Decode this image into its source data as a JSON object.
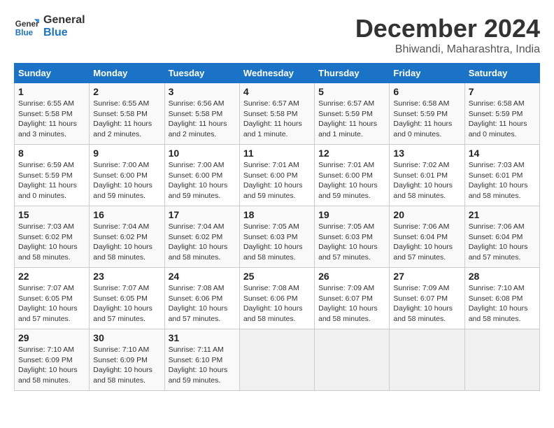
{
  "logo": {
    "text_line1": "General",
    "text_line2": "Blue"
  },
  "title": "December 2024",
  "location": "Bhiwandi, Maharashtra, India",
  "weekdays": [
    "Sunday",
    "Monday",
    "Tuesday",
    "Wednesday",
    "Thursday",
    "Friday",
    "Saturday"
  ],
  "weeks": [
    [
      {
        "day": "1",
        "info": "Sunrise: 6:55 AM\nSunset: 5:58 PM\nDaylight: 11 hours\nand 3 minutes."
      },
      {
        "day": "2",
        "info": "Sunrise: 6:55 AM\nSunset: 5:58 PM\nDaylight: 11 hours\nand 2 minutes."
      },
      {
        "day": "3",
        "info": "Sunrise: 6:56 AM\nSunset: 5:58 PM\nDaylight: 11 hours\nand 2 minutes."
      },
      {
        "day": "4",
        "info": "Sunrise: 6:57 AM\nSunset: 5:58 PM\nDaylight: 11 hours\nand 1 minute."
      },
      {
        "day": "5",
        "info": "Sunrise: 6:57 AM\nSunset: 5:59 PM\nDaylight: 11 hours\nand 1 minute."
      },
      {
        "day": "6",
        "info": "Sunrise: 6:58 AM\nSunset: 5:59 PM\nDaylight: 11 hours\nand 0 minutes."
      },
      {
        "day": "7",
        "info": "Sunrise: 6:58 AM\nSunset: 5:59 PM\nDaylight: 11 hours\nand 0 minutes."
      }
    ],
    [
      {
        "day": "8",
        "info": "Sunrise: 6:59 AM\nSunset: 5:59 PM\nDaylight: 11 hours\nand 0 minutes."
      },
      {
        "day": "9",
        "info": "Sunrise: 7:00 AM\nSunset: 6:00 PM\nDaylight: 10 hours\nand 59 minutes."
      },
      {
        "day": "10",
        "info": "Sunrise: 7:00 AM\nSunset: 6:00 PM\nDaylight: 10 hours\nand 59 minutes."
      },
      {
        "day": "11",
        "info": "Sunrise: 7:01 AM\nSunset: 6:00 PM\nDaylight: 10 hours\nand 59 minutes."
      },
      {
        "day": "12",
        "info": "Sunrise: 7:01 AM\nSunset: 6:00 PM\nDaylight: 10 hours\nand 59 minutes."
      },
      {
        "day": "13",
        "info": "Sunrise: 7:02 AM\nSunset: 6:01 PM\nDaylight: 10 hours\nand 58 minutes."
      },
      {
        "day": "14",
        "info": "Sunrise: 7:03 AM\nSunset: 6:01 PM\nDaylight: 10 hours\nand 58 minutes."
      }
    ],
    [
      {
        "day": "15",
        "info": "Sunrise: 7:03 AM\nSunset: 6:02 PM\nDaylight: 10 hours\nand 58 minutes."
      },
      {
        "day": "16",
        "info": "Sunrise: 7:04 AM\nSunset: 6:02 PM\nDaylight: 10 hours\nand 58 minutes."
      },
      {
        "day": "17",
        "info": "Sunrise: 7:04 AM\nSunset: 6:02 PM\nDaylight: 10 hours\nand 58 minutes."
      },
      {
        "day": "18",
        "info": "Sunrise: 7:05 AM\nSunset: 6:03 PM\nDaylight: 10 hours\nand 58 minutes."
      },
      {
        "day": "19",
        "info": "Sunrise: 7:05 AM\nSunset: 6:03 PM\nDaylight: 10 hours\nand 57 minutes."
      },
      {
        "day": "20",
        "info": "Sunrise: 7:06 AM\nSunset: 6:04 PM\nDaylight: 10 hours\nand 57 minutes."
      },
      {
        "day": "21",
        "info": "Sunrise: 7:06 AM\nSunset: 6:04 PM\nDaylight: 10 hours\nand 57 minutes."
      }
    ],
    [
      {
        "day": "22",
        "info": "Sunrise: 7:07 AM\nSunset: 6:05 PM\nDaylight: 10 hours\nand 57 minutes."
      },
      {
        "day": "23",
        "info": "Sunrise: 7:07 AM\nSunset: 6:05 PM\nDaylight: 10 hours\nand 57 minutes."
      },
      {
        "day": "24",
        "info": "Sunrise: 7:08 AM\nSunset: 6:06 PM\nDaylight: 10 hours\nand 57 minutes."
      },
      {
        "day": "25",
        "info": "Sunrise: 7:08 AM\nSunset: 6:06 PM\nDaylight: 10 hours\nand 58 minutes."
      },
      {
        "day": "26",
        "info": "Sunrise: 7:09 AM\nSunset: 6:07 PM\nDaylight: 10 hours\nand 58 minutes."
      },
      {
        "day": "27",
        "info": "Sunrise: 7:09 AM\nSunset: 6:07 PM\nDaylight: 10 hours\nand 58 minutes."
      },
      {
        "day": "28",
        "info": "Sunrise: 7:10 AM\nSunset: 6:08 PM\nDaylight: 10 hours\nand 58 minutes."
      }
    ],
    [
      {
        "day": "29",
        "info": "Sunrise: 7:10 AM\nSunset: 6:09 PM\nDaylight: 10 hours\nand 58 minutes."
      },
      {
        "day": "30",
        "info": "Sunrise: 7:10 AM\nSunset: 6:09 PM\nDaylight: 10 hours\nand 58 minutes."
      },
      {
        "day": "31",
        "info": "Sunrise: 7:11 AM\nSunset: 6:10 PM\nDaylight: 10 hours\nand 59 minutes."
      },
      {
        "day": "",
        "info": ""
      },
      {
        "day": "",
        "info": ""
      },
      {
        "day": "",
        "info": ""
      },
      {
        "day": "",
        "info": ""
      }
    ]
  ]
}
